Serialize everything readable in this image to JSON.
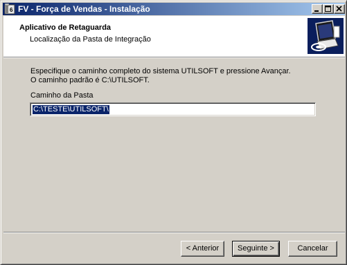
{
  "window": {
    "title": "FV - Força de Vendas - Instalação",
    "controls": {
      "minimize": "minimize-icon",
      "maximize": "maximize-icon",
      "close": "close-icon"
    }
  },
  "header": {
    "title": "Aplicativo de Retaguarda",
    "subtitle": "Localização da Pasta de Integração",
    "graphic_icon": "computer-disk-icon"
  },
  "body": {
    "description_line1": "Especifique o caminho completo do sistema UTILSOFT e pressione Avançar.",
    "description_line2": "O caminho padrão é C:\\UTILSOFT.",
    "field_label": "Caminho da Pasta",
    "field_value": "C:\\TESTE\\UTILSOFT\\"
  },
  "buttons": {
    "back": "< Anterior",
    "next": "Seguinte >",
    "cancel": "Cancelar"
  },
  "colors": {
    "titlebar_start": "#0a246a",
    "titlebar_end": "#a6caf0",
    "face": "#d4d0c8",
    "selection": "#0a246a"
  }
}
